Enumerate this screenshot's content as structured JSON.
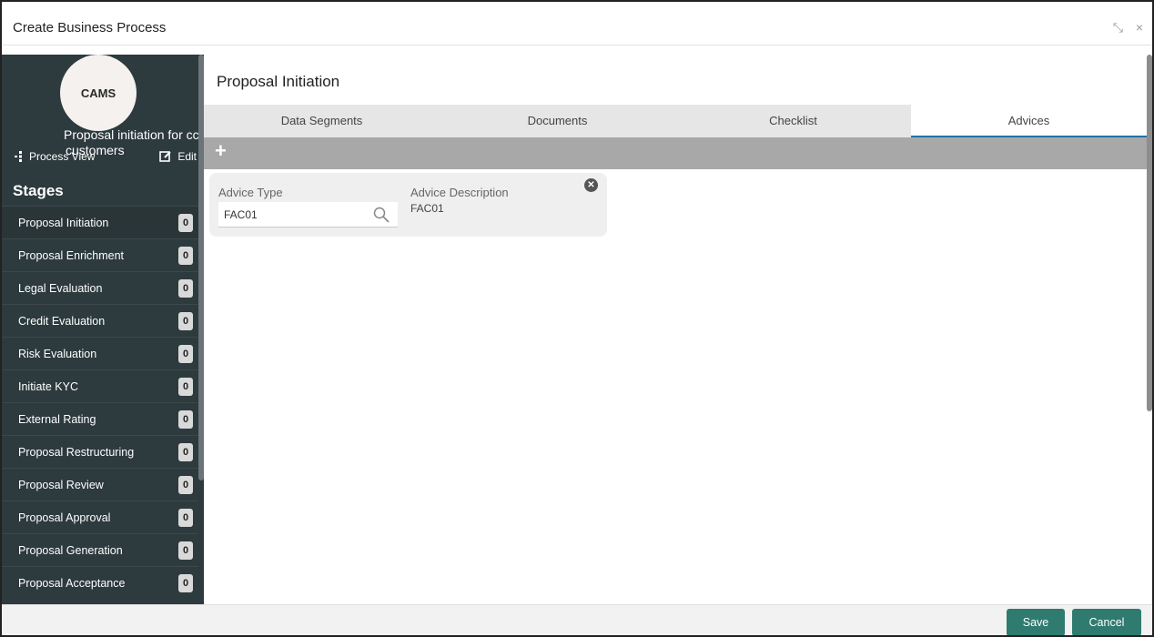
{
  "window": {
    "title": "Create Business Process",
    "minimize_glyph": "⤡",
    "close_glyph": "×"
  },
  "sidebar": {
    "logo_text": "CAMS",
    "process_name_line1": "Proposal initiation for cc",
    "process_name_line2": "customers",
    "process_view_label": "Process View",
    "edit_label": "Edit",
    "stages_title": "Stages",
    "stages": [
      {
        "label": "Proposal Initiation",
        "count": "0"
      },
      {
        "label": "Proposal Enrichment",
        "count": "0"
      },
      {
        "label": "Legal Evaluation",
        "count": "0"
      },
      {
        "label": "Credit Evaluation",
        "count": "0"
      },
      {
        "label": "Risk Evaluation",
        "count": "0"
      },
      {
        "label": "Initiate KYC",
        "count": "0"
      },
      {
        "label": "External Rating",
        "count": "0"
      },
      {
        "label": "Proposal Restructuring",
        "count": "0"
      },
      {
        "label": "Proposal Review",
        "count": "0"
      },
      {
        "label": "Proposal Approval",
        "count": "0"
      },
      {
        "label": "Proposal Generation",
        "count": "0"
      },
      {
        "label": "Proposal Acceptance",
        "count": "0"
      }
    ]
  },
  "main": {
    "heading": "Proposal Initiation",
    "tabs": [
      {
        "label": "Data Segments"
      },
      {
        "label": "Documents"
      },
      {
        "label": "Checklist"
      },
      {
        "label": "Advices"
      }
    ],
    "active_tab": "Advices",
    "add_glyph": "+",
    "advice_card": {
      "type_label": "Advice Type",
      "type_value": "FAC01",
      "description_label": "Advice Description",
      "description_value": "FAC01"
    }
  },
  "footer": {
    "save_label": "Save",
    "cancel_label": "Cancel"
  },
  "colors": {
    "sidebar_bg": "#2d3a3e",
    "accent_tab": "#1f73a8",
    "button": "#2f7b6f"
  },
  "icons": [
    "process-view-icon",
    "edit-icon",
    "search-icon",
    "close-icon",
    "add-icon",
    "minimize-icon"
  ]
}
